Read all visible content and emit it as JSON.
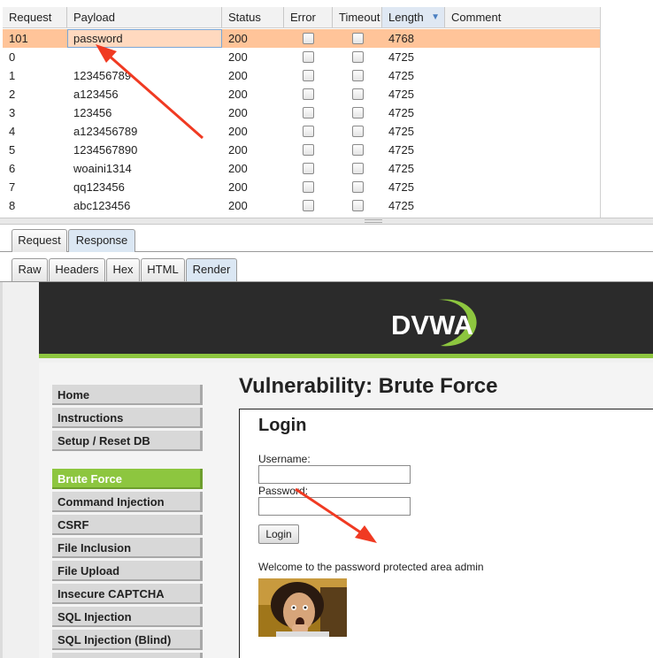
{
  "results": {
    "columns": [
      "Request",
      "Payload",
      "Status",
      "Error",
      "Timeout",
      "Length",
      "Comment"
    ],
    "sorted_column": "Length",
    "rows": [
      {
        "request": "101",
        "payload": "password",
        "status": "200",
        "error": false,
        "timeout": false,
        "length": "4768",
        "comment": "",
        "selected": true
      },
      {
        "request": "0",
        "payload": "",
        "status": "200",
        "error": false,
        "timeout": false,
        "length": "4725",
        "comment": ""
      },
      {
        "request": "1",
        "payload": "123456789",
        "status": "200",
        "error": false,
        "timeout": false,
        "length": "4725",
        "comment": ""
      },
      {
        "request": "2",
        "payload": "a123456",
        "status": "200",
        "error": false,
        "timeout": false,
        "length": "4725",
        "comment": ""
      },
      {
        "request": "3",
        "payload": "123456",
        "status": "200",
        "error": false,
        "timeout": false,
        "length": "4725",
        "comment": ""
      },
      {
        "request": "4",
        "payload": "a123456789",
        "status": "200",
        "error": false,
        "timeout": false,
        "length": "4725",
        "comment": ""
      },
      {
        "request": "5",
        "payload": "1234567890",
        "status": "200",
        "error": false,
        "timeout": false,
        "length": "4725",
        "comment": ""
      },
      {
        "request": "6",
        "payload": "woaini1314",
        "status": "200",
        "error": false,
        "timeout": false,
        "length": "4725",
        "comment": ""
      },
      {
        "request": "7",
        "payload": "qq123456",
        "status": "200",
        "error": false,
        "timeout": false,
        "length": "4725",
        "comment": ""
      },
      {
        "request": "8",
        "payload": "abc123456",
        "status": "200",
        "error": false,
        "timeout": false,
        "length": "4725",
        "comment": ""
      }
    ]
  },
  "tabs_top": [
    {
      "label": "Request",
      "active": false
    },
    {
      "label": "Response",
      "active": true
    }
  ],
  "tabs_view": [
    {
      "label": "Raw",
      "active": false
    },
    {
      "label": "Headers",
      "active": false
    },
    {
      "label": "Hex",
      "active": false
    },
    {
      "label": "HTML",
      "active": false
    },
    {
      "label": "Render",
      "active": true
    }
  ],
  "dvwa": {
    "logo_text": "DVWA",
    "page_title": "Vulnerability: Brute Force",
    "menu_group1": [
      "Home",
      "Instructions",
      "Setup / Reset DB"
    ],
    "menu_group2": [
      "Brute Force",
      "Command Injection",
      "CSRF",
      "File Inclusion",
      "File Upload",
      "Insecure CAPTCHA",
      "SQL Injection",
      "SQL Injection (Blind)"
    ],
    "active_menu": "Brute Force",
    "login": {
      "title": "Login",
      "username_label": "Username:",
      "password_label": "Password:",
      "button_label": "Login",
      "welcome_text": "Welcome to the password protected area admin"
    }
  },
  "colors": {
    "selected_row": "#ffc499",
    "dvwa_green": "#8dc63f",
    "dvwa_header": "#2b2b2b",
    "annotation_arrow": "#f03a22"
  },
  "icons": {
    "sort": "sort-descending-icon",
    "annotations": [
      "red-arrow-to-payload",
      "red-arrow-to-welcome-message"
    ]
  }
}
